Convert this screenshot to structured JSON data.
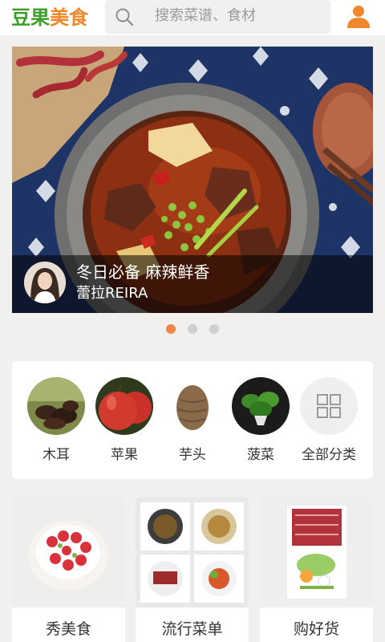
{
  "header": {
    "logo_green": "豆果",
    "logo_orange": "美食",
    "search_placeholder": "搜索菜谱、食材",
    "icons": {
      "search": "search-icon",
      "user": "user-icon"
    }
  },
  "banner": {
    "title": "冬日必备 麻辣鲜香",
    "author": "蕾拉REIRA",
    "active_index": 0,
    "slide_count": 3
  },
  "categories": [
    {
      "label": "木耳"
    },
    {
      "label": "苹果"
    },
    {
      "label": "芋头"
    },
    {
      "label": "菠菜"
    },
    {
      "label": "全部分类",
      "icon": "grid-icon"
    }
  ],
  "cards": [
    {
      "title": "秀美食"
    },
    {
      "title": "流行菜单"
    },
    {
      "title": "购好货"
    }
  ],
  "colors": {
    "brand_green": "#3f9e2a",
    "brand_orange": "#f2862b",
    "dot_active": "#f2864a"
  }
}
